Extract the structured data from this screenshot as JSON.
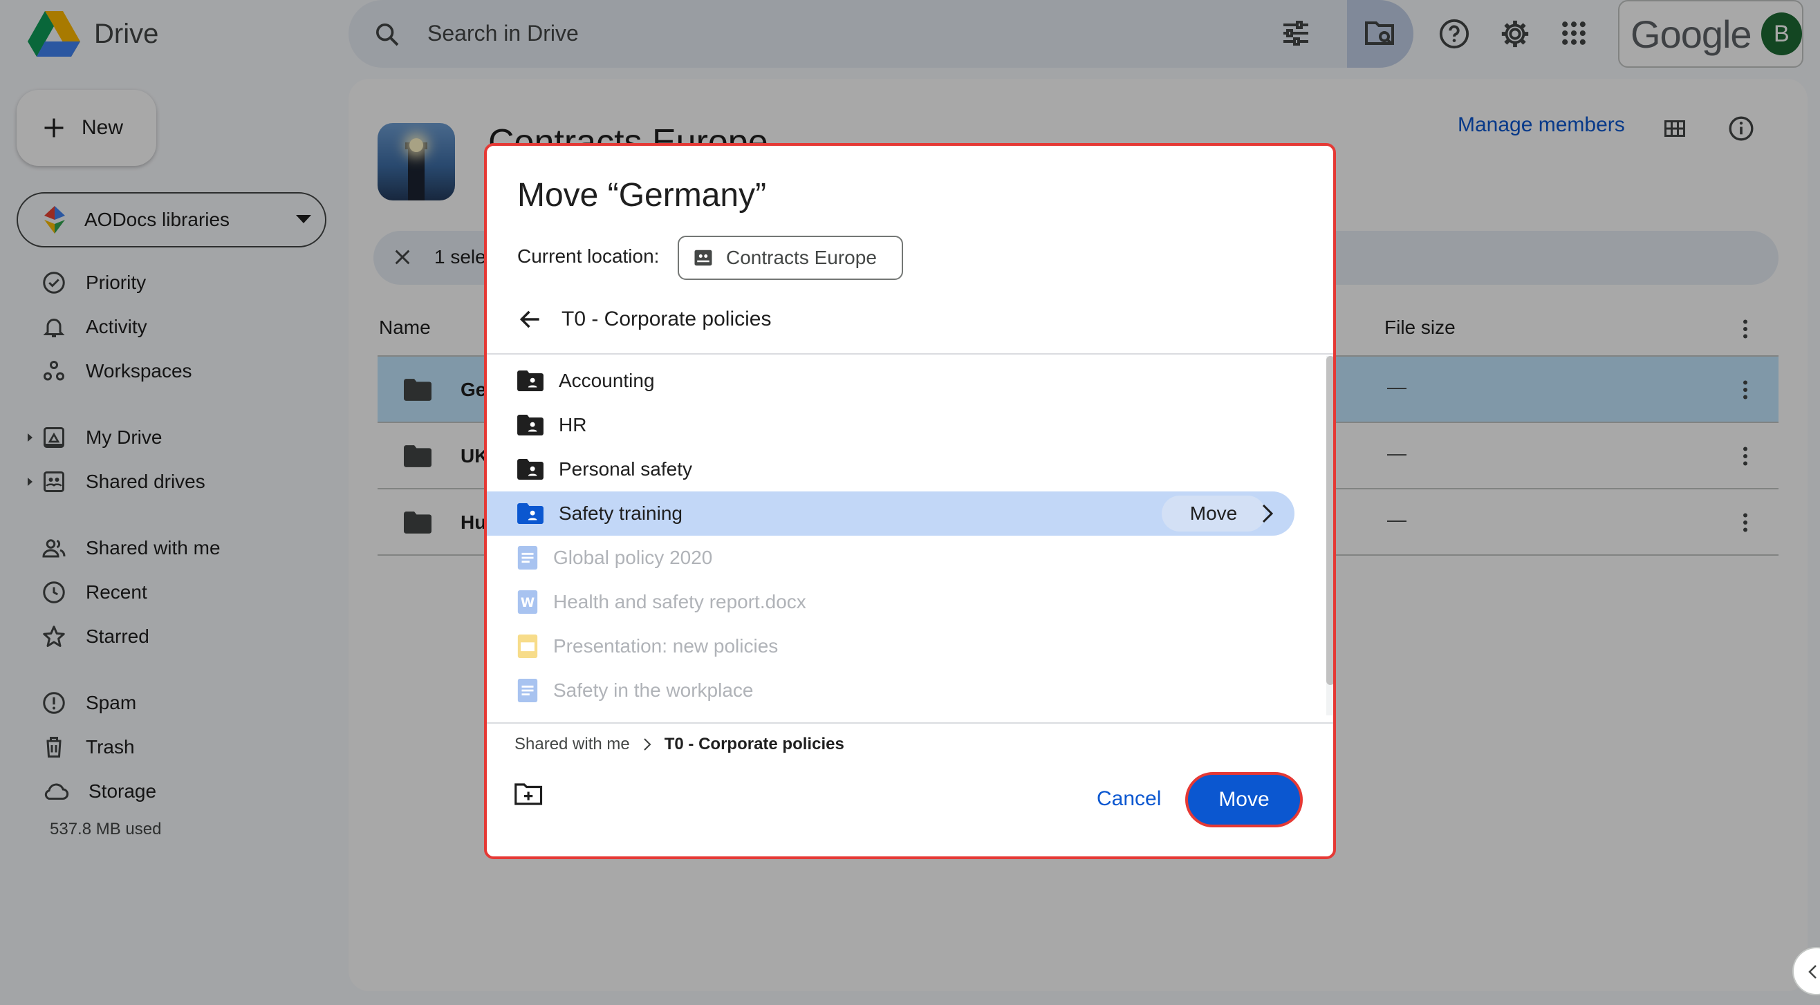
{
  "app": {
    "name": "Drive"
  },
  "search": {
    "placeholder": "Search in Drive"
  },
  "account": {
    "brand": "Google",
    "avatar_letter": "B",
    "avatar_color": "#1e6b34"
  },
  "sidebar": {
    "new_label": "New",
    "library_select": "AODocs libraries",
    "items": [
      {
        "label": "Priority",
        "icon": "priority-icon"
      },
      {
        "label": "Activity",
        "icon": "bell-icon"
      },
      {
        "label": "Workspaces",
        "icon": "workspaces-icon"
      },
      {
        "label": "My Drive",
        "icon": "my-drive-icon"
      },
      {
        "label": "Shared drives",
        "icon": "shared-drives-icon"
      },
      {
        "label": "Shared with me",
        "icon": "people-icon"
      },
      {
        "label": "Recent",
        "icon": "clock-icon"
      },
      {
        "label": "Starred",
        "icon": "star-icon"
      },
      {
        "label": "Spam",
        "icon": "spam-icon"
      },
      {
        "label": "Trash",
        "icon": "trash-icon"
      },
      {
        "label": "Storage",
        "icon": "cloud-icon"
      }
    ],
    "storage_used": "537.8 MB used"
  },
  "main": {
    "drive_title": "Contracts Europe",
    "manage_members": "Manage members",
    "selection_text": "1 sele",
    "columns": {
      "name": "Name",
      "file_size": "File size"
    },
    "rows": [
      {
        "name": "Ge",
        "size": "—",
        "selected": true
      },
      {
        "name": "UK",
        "size": "—",
        "selected": false
      },
      {
        "name": "Hu",
        "size": "—",
        "selected": false
      }
    ]
  },
  "dialog": {
    "title": "Move “Germany”",
    "current_location_label": "Current location:",
    "current_location": "Contracts Europe",
    "folder_title": "T0 - Corporate policies",
    "items": [
      {
        "name": "Accounting",
        "type": "shared-folder",
        "disabled": false
      },
      {
        "name": "HR",
        "type": "shared-folder",
        "disabled": false
      },
      {
        "name": "Personal safety",
        "type": "shared-folder",
        "disabled": false
      },
      {
        "name": "Safety training",
        "type": "shared-folder",
        "disabled": false,
        "highlighted": true,
        "action": "Move"
      },
      {
        "name": "Global policy 2020",
        "type": "doc",
        "disabled": true
      },
      {
        "name": "Health and safety report.docx",
        "type": "word",
        "disabled": true
      },
      {
        "name": "Presentation: new policies",
        "type": "slides",
        "disabled": true
      },
      {
        "name": "Safety in the workplace",
        "type": "doc",
        "disabled": true
      }
    ],
    "breadcrumb": {
      "root": "Shared with me",
      "current": "T0 - Corporate policies"
    },
    "cancel_label": "Cancel",
    "move_label": "Move",
    "highlight_color": "#e53935"
  }
}
